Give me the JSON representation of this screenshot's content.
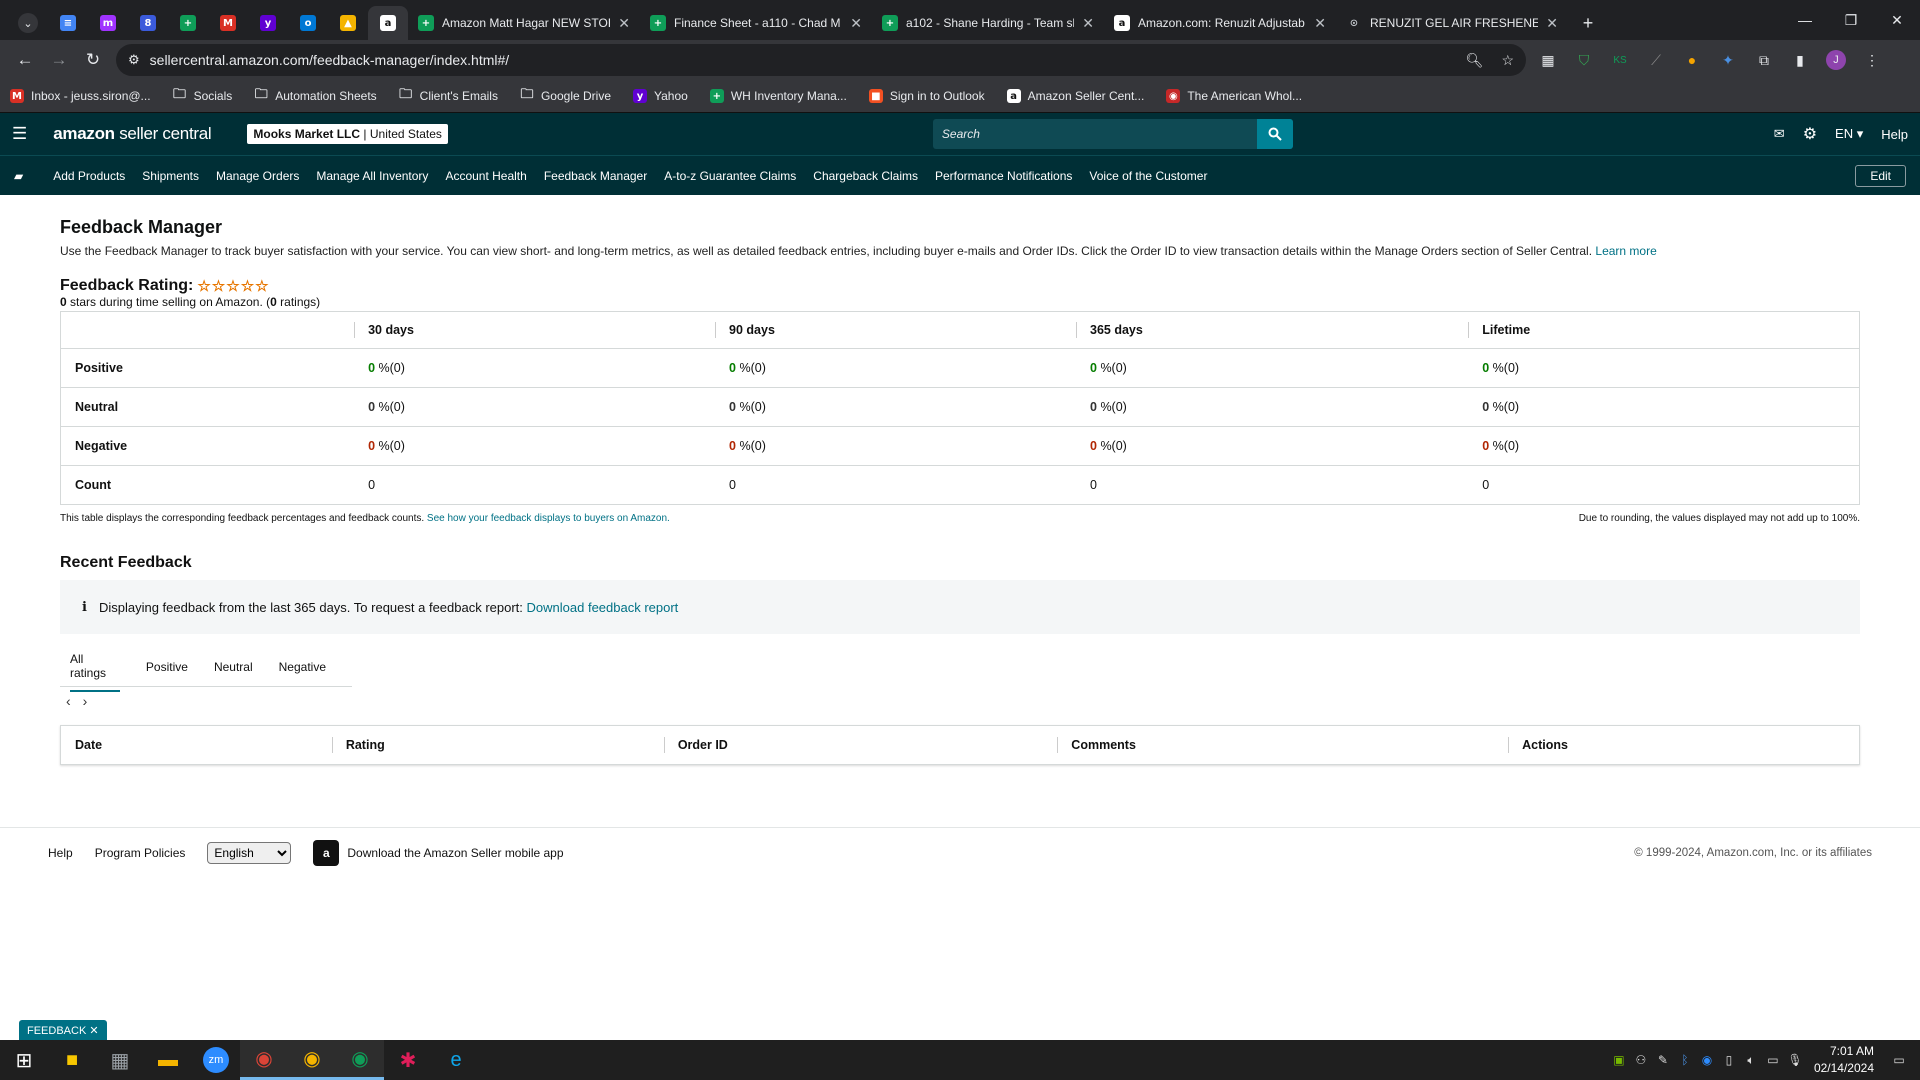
{
  "browser": {
    "pinned_tabs": [
      {
        "icon": "docs-icon",
        "color": "#4285f4",
        "glyph": "≡"
      },
      {
        "icon": "messenger-icon",
        "color": "#a033ff",
        "glyph": "m"
      },
      {
        "icon": "app-8-icon",
        "color": "#3b5bdb",
        "glyph": "8"
      },
      {
        "icon": "sheets-icon",
        "color": "#0f9d58",
        "glyph": "+"
      },
      {
        "icon": "gmail-icon",
        "color": "#d93025",
        "glyph": "M"
      },
      {
        "icon": "yahoo-icon",
        "color": "#6001d2",
        "glyph": "y"
      },
      {
        "icon": "outlook-icon",
        "color": "#0078d4",
        "glyph": "o"
      },
      {
        "icon": "drive-icon",
        "color": "#f4b400",
        "glyph": "▲"
      },
      {
        "icon": "amazon-tab-icon",
        "color": "#111111",
        "glyph": "a"
      }
    ],
    "tabs": [
      {
        "title": "Amazon Matt Hagar NEW STOR",
        "icon": "sheets-icon",
        "color": "#0f9d58",
        "glyph": "+"
      },
      {
        "title": "Finance Sheet - a110 - Chad M",
        "icon": "sheets-icon",
        "color": "#0f9d58",
        "glyph": "+"
      },
      {
        "title": "a102 - Shane Harding - Team sl",
        "icon": "sheets-icon",
        "color": "#0f9d58",
        "glyph": "+"
      },
      {
        "title": "Amazon.com: Renuzit Adjustab",
        "icon": "amazon-icon",
        "color": "#ffffff",
        "glyph": "a"
      },
      {
        "title": "RENUZIT GEL AIR FRESHENER-",
        "icon": "globe-icon",
        "color": "#5f6368",
        "glyph": "⊙"
      }
    ],
    "url": "sellercentral.amazon.com/feedback-manager/index.html#/",
    "bookmarks": [
      {
        "label": "Inbox - jeuss.siron@...",
        "icon": "gmail-icon",
        "color": "#d93025",
        "glyph": "M"
      },
      {
        "label": "Socials",
        "icon": "folder-icon",
        "color": "",
        "glyph": "🗀"
      },
      {
        "label": "Automation Sheets",
        "icon": "folder-icon",
        "color": "",
        "glyph": "🗀"
      },
      {
        "label": "Client's Emails",
        "icon": "folder-icon",
        "color": "",
        "glyph": "🗀"
      },
      {
        "label": "Google Drive",
        "icon": "folder-icon",
        "color": "",
        "glyph": "🗀"
      },
      {
        "label": "Yahoo",
        "icon": "yahoo-icon",
        "color": "#6001d2",
        "glyph": "y"
      },
      {
        "label": "WH Inventory Mana...",
        "icon": "sheets-icon",
        "color": "#0f9d58",
        "glyph": "+"
      },
      {
        "label": "Sign in to Outlook",
        "icon": "microsoft-icon",
        "color": "#f25022",
        "glyph": "■"
      },
      {
        "label": "Amazon Seller Cent...",
        "icon": "amazon-icon",
        "color": "#ffffff",
        "glyph": "a"
      },
      {
        "label": "The American Whol...",
        "icon": "store-icon",
        "color": "#c62828",
        "glyph": "◉"
      }
    ]
  },
  "header": {
    "logo_main": "amazon",
    "logo_sub": "seller central",
    "store_name": "Mooks Market LLC",
    "store_region": "United States",
    "search_placeholder": "Search",
    "lang": "EN ▾",
    "help": "Help"
  },
  "nav": {
    "links": [
      "Add Products",
      "Shipments",
      "Manage Orders",
      "Manage All Inventory",
      "Account Health",
      "Feedback Manager",
      "A-to-z Guarantee Claims",
      "Chargeback Claims",
      "Performance Notifications",
      "Voice of the Customer"
    ],
    "edit": "Edit"
  },
  "page": {
    "title": "Feedback Manager",
    "intro": "Use the Feedback Manager to track buyer satisfaction with your service. You can view short- and long-term metrics, as well as detailed feedback entries, including buyer e-mails and Order IDs. Click the Order ID to view transaction details within the Manage Orders section of Seller Central.",
    "learn_more": "Learn more",
    "rating_label": "Feedback Rating:",
    "stars": "☆☆☆☆☆",
    "rating_value": "0",
    "rating_text": " stars during time selling on Amazon. (",
    "rating_count": "0",
    "rating_tail": " ratings)"
  },
  "metrics": {
    "columns": [
      "30 days",
      "90 days",
      "365 days",
      "Lifetime"
    ],
    "rows": [
      {
        "label": "Positive",
        "cls": "pos",
        "cells": [
          "0",
          "0",
          "0",
          "0"
        ],
        "suffix": " %(0)"
      },
      {
        "label": "Neutral",
        "cls": "neu",
        "cells": [
          "0",
          "0",
          "0",
          "0"
        ],
        "suffix": " %(0)"
      },
      {
        "label": "Negative",
        "cls": "neg",
        "cells": [
          "0",
          "0",
          "0",
          "0"
        ],
        "suffix": " %(0)"
      },
      {
        "label": "Count",
        "cls": "",
        "cells": [
          "0",
          "0",
          "0",
          "0"
        ],
        "suffix": ""
      }
    ],
    "note_left": "This table displays the corresponding feedback percentages and feedback counts.",
    "note_link": "See how your feedback displays to buyers on Amazon.",
    "note_right": "Due to rounding, the values displayed may not add up to 100%."
  },
  "recent": {
    "title": "Recent Feedback",
    "info_text": "Displaying feedback from the last 365 days. To request a feedback report:",
    "info_link": "Download feedback report",
    "tabs": [
      "All ratings",
      "Positive",
      "Neutral",
      "Negative"
    ],
    "columns": [
      "Date",
      "Rating",
      "Order ID",
      "Comments",
      "Actions"
    ]
  },
  "footer": {
    "help": "Help",
    "policies": "Program Policies",
    "language": "English",
    "app_text": "Download the Amazon Seller mobile app",
    "copyright": "© 1999-2024, Amazon.com, Inc. or its affiliates",
    "feedback_tag": "FEEDBACK ✕"
  },
  "taskbar": {
    "time": "7:01 AM",
    "date": "02/14/2024",
    "apps": [
      {
        "icon": "windows-start-icon",
        "color": "#ffffff",
        "glyph": "⊞"
      },
      {
        "icon": "sticky-notes-icon",
        "color": "#f7c600",
        "glyph": "■"
      },
      {
        "icon": "calculator-icon",
        "color": "#9aa0a6",
        "glyph": "▦"
      },
      {
        "icon": "file-explorer-icon",
        "color": "#f4b400",
        "glyph": "▬"
      },
      {
        "icon": "zoom-icon",
        "color": "#2d8cff",
        "glyph": "zm"
      },
      {
        "icon": "chrome-icon",
        "color": "#db4437",
        "glyph": "◉"
      },
      {
        "icon": "chrome-icon",
        "color": "#f4b400",
        "glyph": "◉"
      },
      {
        "icon": "chrome-icon",
        "color": "#0f9d58",
        "glyph": "◉"
      },
      {
        "icon": "slack-icon",
        "color": "#e01e5a",
        "glyph": "✱"
      },
      {
        "icon": "edge-icon",
        "color": "#0ea5e9",
        "glyph": "e"
      }
    ]
  }
}
